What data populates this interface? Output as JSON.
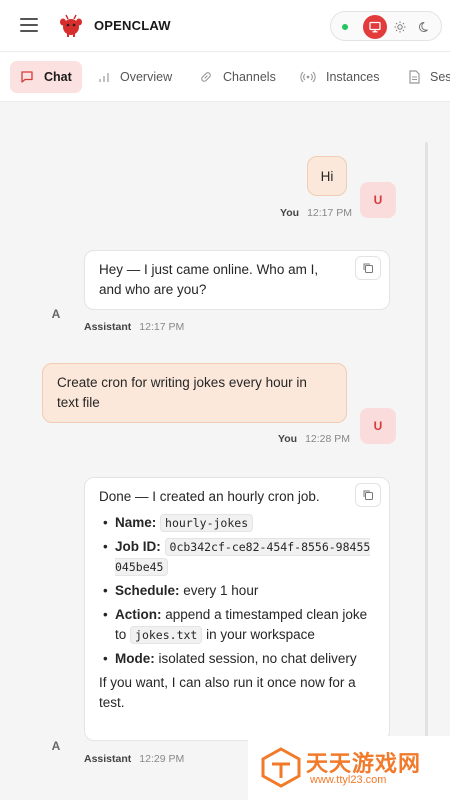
{
  "app": {
    "brand": "OPENCLAW",
    "accent": "#e23b3b",
    "status_color": "#22c55e"
  },
  "tabs": [
    {
      "label": "Chat",
      "icon": "chat-icon",
      "active": true
    },
    {
      "label": "Overview",
      "icon": "bar-chart-icon",
      "active": false
    },
    {
      "label": "Channels",
      "icon": "link-icon",
      "active": false
    },
    {
      "label": "Instances",
      "icon": "broadcast-icon",
      "active": false
    },
    {
      "label": "Ses",
      "icon": "document-icon",
      "active": false
    }
  ],
  "theme_controls": [
    "monitor-icon",
    "sun-icon",
    "moon-icon"
  ],
  "messages": {
    "m1": {
      "text": "Hi",
      "sender": "You",
      "time": "12:17 PM",
      "avatar": "U"
    },
    "m2": {
      "text": "Hey — I just came online. Who am I, and who are you?",
      "sender": "Assistant",
      "time": "12:17 PM",
      "avatar": "A"
    },
    "m3": {
      "text": "Create cron for writing jokes every hour in text file",
      "sender": "You",
      "time": "12:28 PM",
      "avatar": "U"
    },
    "m4": {
      "intro": "Done — I created an hourly cron job.",
      "name_label": "Name:",
      "name_value": "hourly-jokes",
      "jobid_label": "Job ID:",
      "jobid_value": "0cb342cf-ce82-454f-8556-98455045be45",
      "schedule_label": "Schedule:",
      "schedule_value": "every 1 hour",
      "action_label": "Action:",
      "action_pre": "append a timestamped clean joke to",
      "action_code": "jokes.txt",
      "action_post": "in your workspace",
      "mode_label": "Mode:",
      "mode_value": "isolated session, no chat delivery",
      "outro": "If you want, I can also run it once now for a test.",
      "sender": "Assistant",
      "time": "12:29 PM",
      "avatar": "A"
    }
  },
  "watermark": {
    "text": "天天游戏网",
    "url": "www.ttyl23.com"
  }
}
